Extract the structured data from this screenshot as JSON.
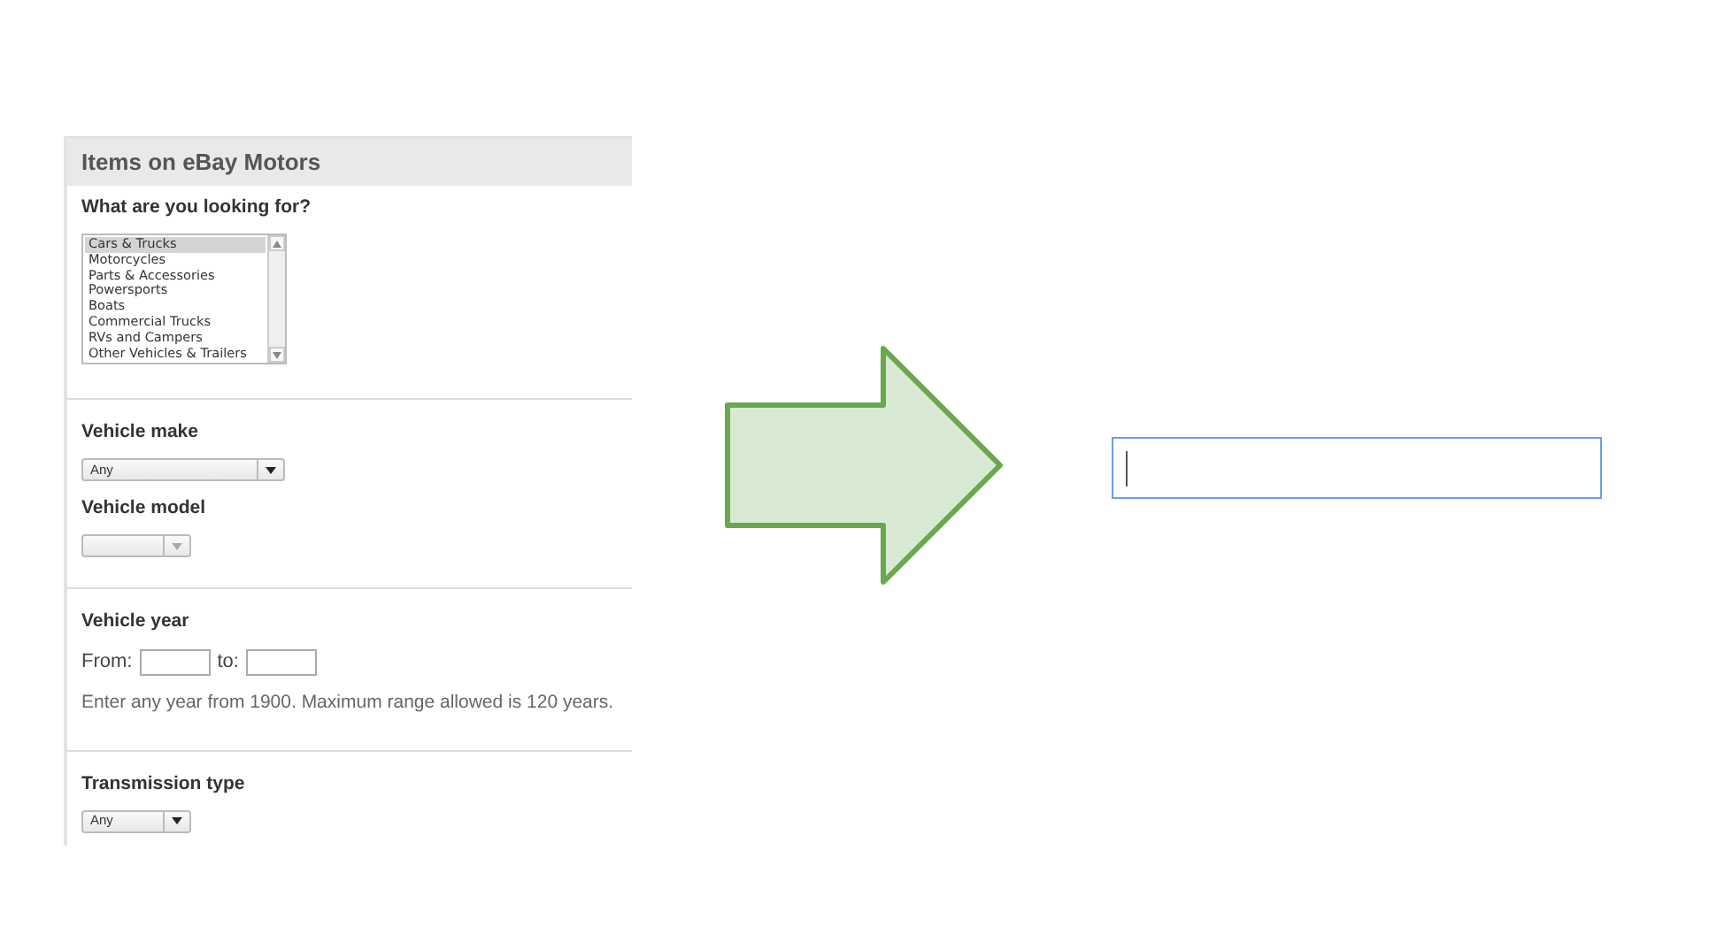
{
  "panel": {
    "title": "Items on eBay Motors",
    "sections": [
      {
        "fields": [
          {
            "kind": "heading",
            "text": "What are you looking for?"
          },
          {
            "kind": "listbox",
            "items": [
              {
                "label": "Cars & Trucks",
                "selected": true
              },
              {
                "label": "Motorcycles",
                "selected": false
              },
              {
                "label": "Parts & Accessories",
                "selected": false
              },
              {
                "label": "Powersports",
                "selected": false
              },
              {
                "label": "Boats",
                "selected": false
              },
              {
                "label": "Commercial Trucks",
                "selected": false
              },
              {
                "label": "RVs and Campers",
                "selected": false
              },
              {
                "label": "Other Vehicles & Trailers",
                "selected": false
              }
            ]
          }
        ]
      },
      {
        "fields": [
          {
            "kind": "heading",
            "text": "Vehicle make"
          },
          {
            "kind": "select",
            "value": "Any",
            "disabled": false
          },
          {
            "kind": "heading",
            "text": "Vehicle model"
          },
          {
            "kind": "dropdown",
            "disabled": true
          }
        ]
      },
      {
        "fields": [
          {
            "kind": "heading",
            "text": "Vehicle year"
          },
          {
            "kind": "range",
            "from_label": "From:",
            "to_label": "to:"
          },
          {
            "kind": "note",
            "text": "Enter any year from 1900. Maximum range allowed is 120 years."
          }
        ]
      },
      {
        "fields": [
          {
            "kind": "heading",
            "text": "Transmission type"
          },
          {
            "kind": "dropdown",
            "value": "Any",
            "disabled": false
          }
        ]
      }
    ]
  },
  "text_field": {
    "focused": true
  }
}
